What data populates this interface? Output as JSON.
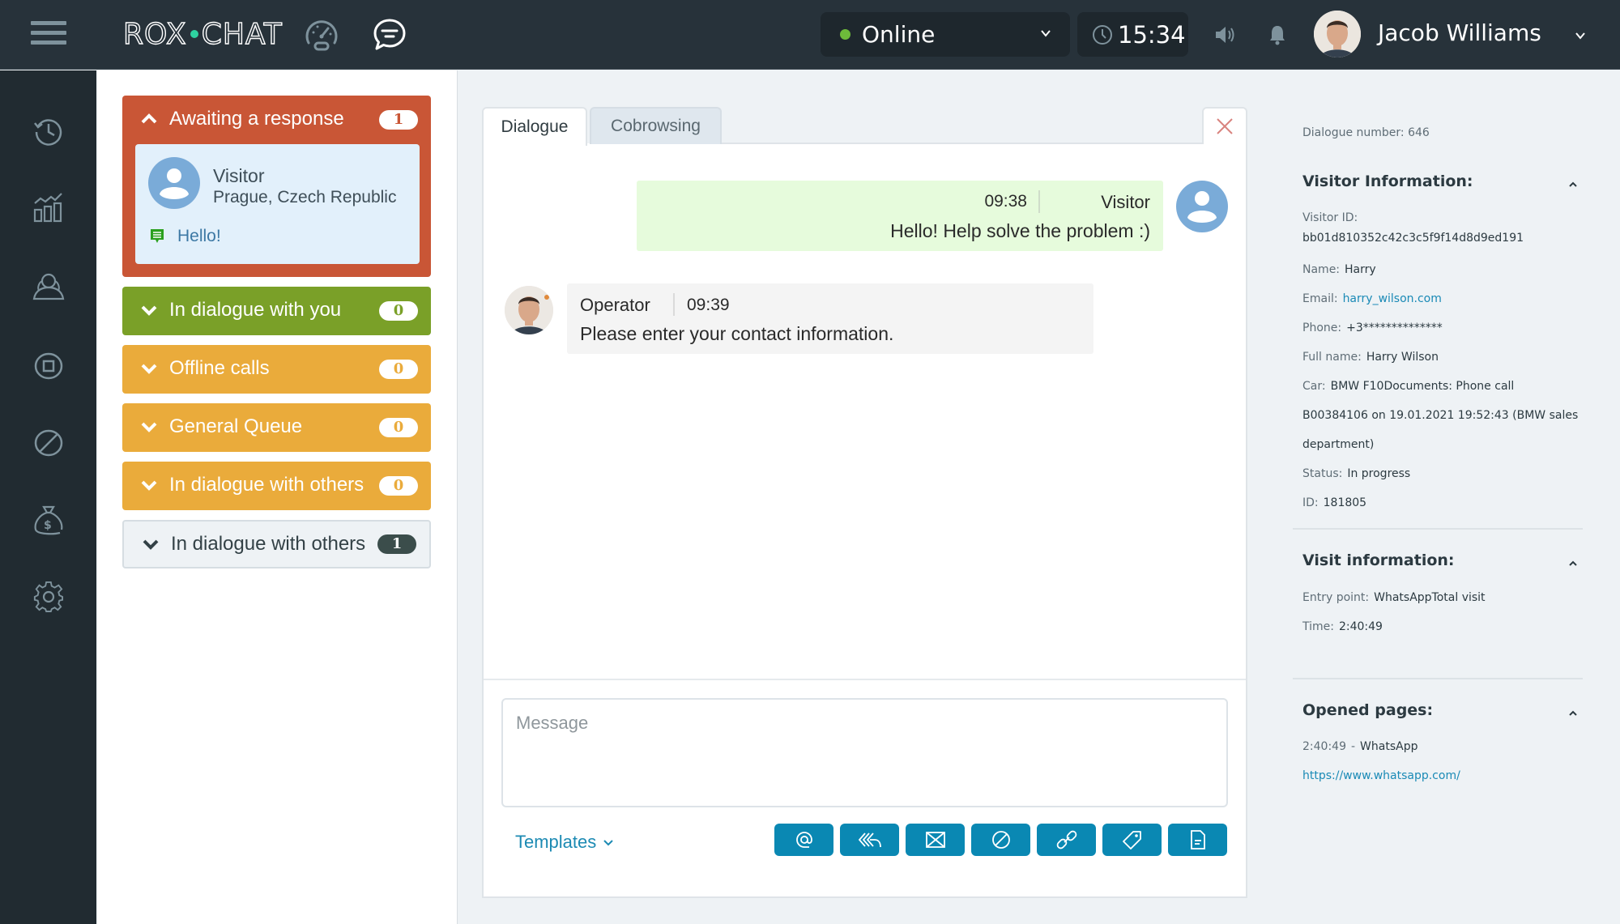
{
  "app": {
    "logo_left": "ROX",
    "logo_right": "CHAT",
    "brand_accent": "#2ed2a0"
  },
  "topbar": {
    "status": "Online",
    "status_color": "#6dbb3a",
    "clock": "15:34",
    "user_name": "Jacob Williams",
    "icons": [
      "menu-icon",
      "speedometer-icon",
      "chat-icon",
      "chevron-down-icon",
      "clock-icon",
      "speaker-icon",
      "bell-icon",
      "avatar",
      "chevron-down-icon"
    ]
  },
  "leftnav": {
    "items": [
      {
        "icon": "history-icon"
      },
      {
        "icon": "statistics-icon"
      },
      {
        "icon": "users-icon"
      },
      {
        "icon": "stop-icon"
      },
      {
        "icon": "blocked-icon"
      },
      {
        "icon": "money-bag-icon"
      },
      {
        "icon": "settings-icon"
      }
    ]
  },
  "queues": [
    {
      "label": "Awaiting a response",
      "count": "1",
      "expanded": true,
      "color": "#c95636"
    },
    {
      "label": "In dialogue with you",
      "count": "0",
      "expanded": false,
      "color": "#7aa028"
    },
    {
      "label": "Offline calls",
      "count": "0",
      "expanded": false,
      "color": "#eaab3b"
    },
    {
      "label": "General Queue",
      "count": "0",
      "expanded": false,
      "color": "#eaab3b"
    },
    {
      "label": "In dialogue with others",
      "count": "0",
      "expanded": false,
      "color": "#eaab3b"
    },
    {
      "label": "In dialogue with others",
      "count": "1",
      "expanded": false,
      "color": "#eef2f5"
    }
  ],
  "visitor_card": {
    "name": "Visitor",
    "location": "Prague, Czech Republic",
    "last_message": "Hello!"
  },
  "chat": {
    "tabs": [
      {
        "label": "Dialogue",
        "active": true
      },
      {
        "label": "Cobrowsing",
        "active": false
      }
    ],
    "messages": [
      {
        "author": "Visitor",
        "time": "09:38",
        "text": "Hello! Help solve the problem :)"
      },
      {
        "author": "Operator",
        "time": "09:39",
        "text": "Please enter your contact information."
      }
    ],
    "input_placeholder": "Message",
    "templates_label": "Templates",
    "toolbar": [
      {
        "icon": "mention-icon"
      },
      {
        "icon": "reply-all-icon"
      },
      {
        "icon": "email-icon"
      },
      {
        "icon": "block-icon"
      },
      {
        "icon": "link-icon"
      },
      {
        "icon": "tag-icon"
      },
      {
        "icon": "document-icon"
      }
    ],
    "accent": "#0a88b3"
  },
  "info_panel": {
    "dialogue_number": "Dialogue number: 646",
    "visitor_info": {
      "title": "Visitor Information:",
      "visitor_id_label": "Visitor ID:",
      "visitor_id": "bb01d810352c42c3c5f9f14d8d9ed191",
      "name_label": "Name:",
      "name": "Harry",
      "email_label": "Email:",
      "email": "harry_wilson.com",
      "phone_label": "Phone:",
      "phone": "+3**************",
      "fullname_label": "Full name:",
      "fullname": "Harry Wilson",
      "car_label": "Car:",
      "car_line1": "BMW F10Documents: Phone call",
      "car_line2": "B00384106 on 19.01.2021 19:52:43 (BMW sales",
      "car_line3": "department)",
      "status_label": "Status:",
      "status": "In progress",
      "id_label": "ID:",
      "id": "181805"
    },
    "visit_info": {
      "title": "Visit information:",
      "entry_label": "Entry point:",
      "entry": "WhatsAppTotal visit",
      "time_label": "Time:",
      "time": "2:40:49"
    },
    "opened_pages": {
      "title": "Opened pages:",
      "time": "2:40:49",
      "separator": "-",
      "page": "WhatsApp",
      "url": "https://www.whatsapp.com/"
    }
  }
}
